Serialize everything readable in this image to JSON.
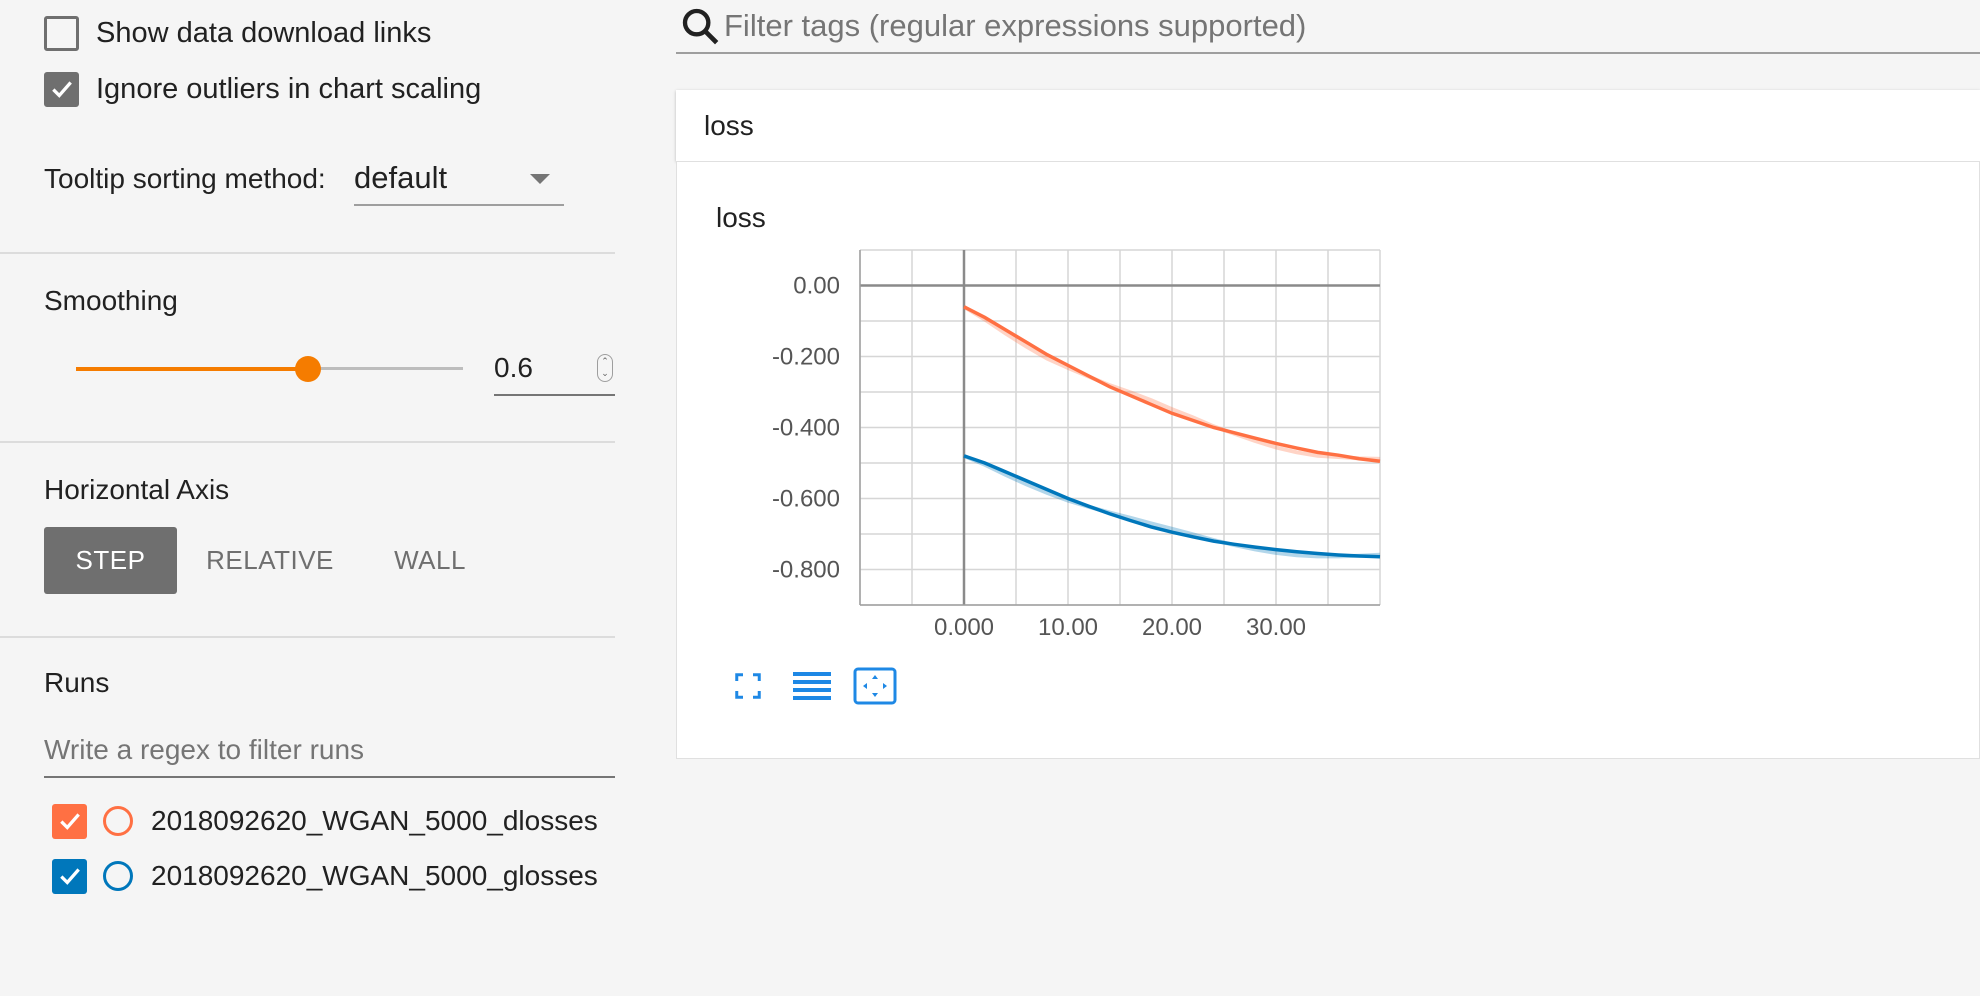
{
  "sidebar": {
    "show_download_links": {
      "label": "Show data download links",
      "checked": false
    },
    "ignore_outliers": {
      "label": "Ignore outliers in chart scaling",
      "checked": true
    },
    "tooltip_sorting": {
      "label": "Tooltip sorting method:",
      "value": "default"
    },
    "smoothing": {
      "title": "Smoothing",
      "value": "0.6",
      "fraction": 0.6,
      "accent": "#f57c00"
    },
    "horizontal_axis": {
      "title": "Horizontal Axis",
      "options": [
        "STEP",
        "RELATIVE",
        "WALL"
      ],
      "selected": "STEP"
    },
    "runs": {
      "title": "Runs",
      "filter_placeholder": "Write a regex to filter runs",
      "items": [
        {
          "label": "2018092620_WGAN_5000_dlosses",
          "color": "#ff7043",
          "checked": true
        },
        {
          "label": "2018092620_WGAN_5000_glosses",
          "color": "#0077bb",
          "checked": true
        }
      ]
    }
  },
  "main": {
    "tag_filter_placeholder": "Filter tags (regular expressions supported)",
    "card_title": "loss",
    "chart_title": "loss",
    "tools": [
      "fullscreen-icon",
      "list-icon",
      "fit-domain-icon"
    ],
    "tool_color": "#1e88e5"
  },
  "chart_data": {
    "type": "line",
    "title": "loss",
    "xlabel": "",
    "ylabel": "",
    "xlim": [
      -10,
      40
    ],
    "ylim": [
      -0.9,
      0.1
    ],
    "x_ticks": [
      "0.000",
      "10.00",
      "20.00",
      "30.00"
    ],
    "y_ticks": [
      "0.00",
      "-0.200",
      "-0.400",
      "-0.600",
      "-0.800"
    ],
    "grid": true,
    "series": [
      {
        "name": "2018092620_WGAN_5000_dlosses",
        "color": "#ff7043",
        "x": [
          0,
          2,
          4,
          6,
          8,
          10,
          12,
          14,
          16,
          18,
          20,
          22,
          24,
          26,
          28,
          30,
          32,
          34,
          36,
          38,
          40
        ],
        "y": [
          -0.06,
          -0.09,
          -0.125,
          -0.16,
          -0.195,
          -0.225,
          -0.255,
          -0.285,
          -0.31,
          -0.335,
          -0.36,
          -0.38,
          -0.4,
          -0.415,
          -0.43,
          -0.445,
          -0.458,
          -0.47,
          -0.478,
          -0.488,
          -0.495
        ]
      },
      {
        "name": "2018092620_WGAN_5000_glosses",
        "color": "#0077bb",
        "x": [
          0,
          2,
          4,
          6,
          8,
          10,
          12,
          14,
          16,
          18,
          20,
          22,
          24,
          26,
          28,
          30,
          32,
          34,
          36,
          38,
          40
        ],
        "y": [
          -0.48,
          -0.5,
          -0.525,
          -0.55,
          -0.575,
          -0.6,
          -0.622,
          -0.643,
          -0.662,
          -0.68,
          -0.695,
          -0.708,
          -0.72,
          -0.729,
          -0.737,
          -0.744,
          -0.75,
          -0.755,
          -0.759,
          -0.762,
          -0.764
        ]
      }
    ]
  }
}
